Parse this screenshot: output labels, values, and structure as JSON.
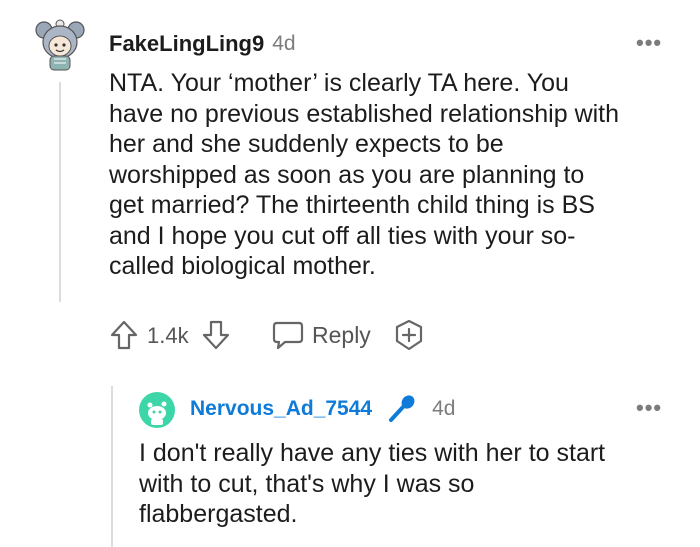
{
  "comment": {
    "username": "FakeLingLing9",
    "age": "4d",
    "body": "NTA. Your ‘mother’ is clearly TA here. You have no previous established relationship with her and she suddenly expects to be worshipped as soon as you are planning to get married? The thirteenth child thing is BS and I hope you cut off all ties with your so-called biological mother.",
    "body_lines": [
      "NTA. Your ‘mother’ is clearly TA here. You",
      "have no previous established relationship with",
      "her and she suddenly expects to be",
      "worshipped as soon as you are planning to",
      "get married? The thirteenth child thing is BS",
      "and I hope you cut off all ties with your so-",
      "called biological mother."
    ],
    "votes": "1.4k",
    "reply_label": "Reply",
    "more_label": "•••"
  },
  "reply": {
    "username": "Nervous_Ad_7544",
    "age": "4d",
    "body_lines": [
      "I don't really have any ties with her to start",
      "with to cut, that's why I was so",
      "flabbergasted."
    ],
    "more_label": "•••"
  },
  "icons": {
    "upvote": "upvote-arrow-icon",
    "downvote": "downvote-arrow-icon",
    "reply": "speech-bubble-icon",
    "award": "award-plus-icon",
    "mic": "microphone-icon"
  },
  "colors": {
    "reply_username": "#0f7bd8",
    "reply_avatar_bg": "#3dd6a8",
    "mic": "#0f7bd8"
  }
}
